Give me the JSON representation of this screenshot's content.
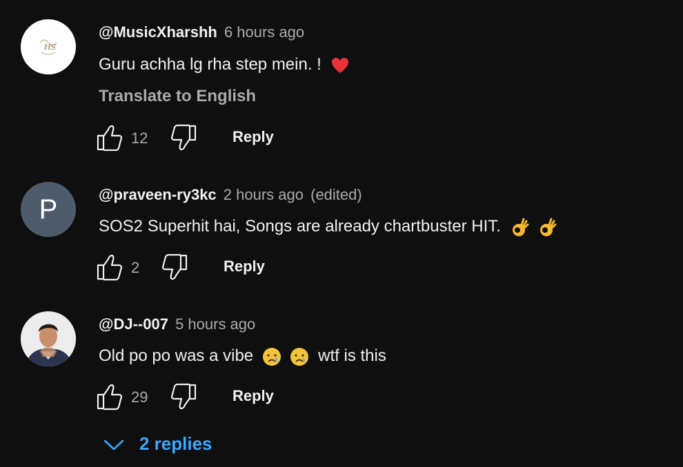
{
  "comments": [
    {
      "author": "@MusicXharshh",
      "time": "6 hours ago",
      "edited": "",
      "text": "Guru achha lg rha step mein. !",
      "emojis": [
        "red-heart"
      ],
      "translate_label": "Translate to English",
      "likes": "12",
      "reply_label": "Reply",
      "avatar_monogram": "HS"
    },
    {
      "author": "@praveen-ry3kc",
      "time": "2 hours ago",
      "edited": "(edited)",
      "text": "SOS2 Superhit hai, Songs are already chartbuster HIT.",
      "emojis": [
        "ok-hand",
        "ok-hand"
      ],
      "likes": "2",
      "reply_label": "Reply",
      "avatar_letter": "P"
    },
    {
      "author": "@DJ--007",
      "time": "5 hours ago",
      "edited": "",
      "text": "Old po po was a vibe",
      "text_after": "wtf is this",
      "emojis": [
        "crying-face",
        "crying-face"
      ],
      "likes": "29",
      "reply_label": "Reply"
    }
  ],
  "replies_toggle": {
    "label": "2 replies",
    "icon": "chevron-down-icon"
  },
  "colors": {
    "background": "#0f0f0f",
    "text_primary": "#f1f1f1",
    "text_secondary": "#aaaaaa",
    "link_blue": "#3ea6ff",
    "avatar_p": "#4d5b6b"
  }
}
